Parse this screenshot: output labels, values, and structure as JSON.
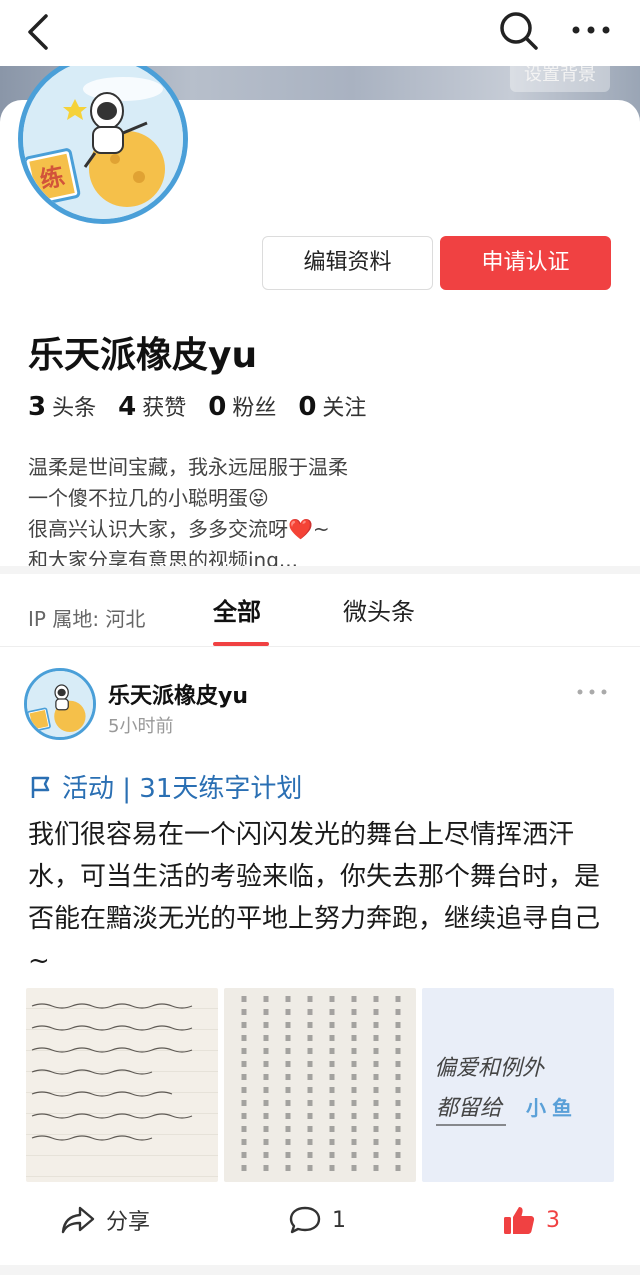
{
  "nav": {
    "back": "back",
    "search": "search",
    "more": "more"
  },
  "banner": {
    "set_background_label": "设置背景"
  },
  "profile": {
    "edit_button": "编辑资料",
    "verify_button": "申请认证",
    "name": "乐天派橡皮yu",
    "avatar_badge": "练",
    "stats": [
      {
        "num": "3",
        "label": "头条"
      },
      {
        "num": "4",
        "label": "获赞"
      },
      {
        "num": "0",
        "label": "粉丝"
      },
      {
        "num": "0",
        "label": "关注"
      }
    ],
    "bio": [
      "温柔是世间宝藏，我永远屈服于温柔",
      "一个傻不拉几的小聪明蛋😝",
      "很高兴认识大家，多多交流呀❤️~",
      "和大家分享有意思的视频ing..."
    ],
    "ip": "IP 属地: 河北"
  },
  "tabs": [
    {
      "label": "全部"
    },
    {
      "label": "微头条"
    }
  ],
  "post": {
    "author": "乐天派橡皮yu",
    "time": "5小时前",
    "activity": "活动 | 31天练字计划",
    "text": "我们很容易在一个闪闪发光的舞台上尽情挥洒汗水，可当生活的考验来临，你失去那个舞台时，是否能在黯淡无光的平地上努力奔跑，继续追寻自己~",
    "image3_text_line1": "偏爱和例外",
    "image3_text_line2": "都留给",
    "image3_text_highlight": "小鱼",
    "actions": {
      "share": "分享",
      "comments": "1",
      "likes": "3"
    }
  },
  "colors": {
    "accent_red": "#f04142",
    "link_blue": "#2a6fb3",
    "avatar_ring": "#4a9fd8"
  }
}
